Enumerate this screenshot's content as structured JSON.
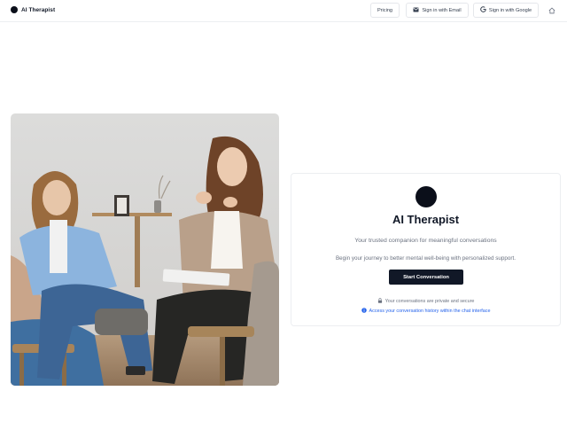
{
  "header": {
    "brand": "AI Therapist",
    "nav": {
      "pricing": "Pricing",
      "email": "Sign in with Email",
      "google": "Sign in with Google"
    }
  },
  "hero": {
    "icon": "group-therapy-photo"
  },
  "card": {
    "title": "AI Therapist",
    "subtitle": "Your trusted companion for meaningful conversations",
    "description": "Begin your journey to better mental well-being with personalized support.",
    "button": "Start Conversation",
    "privacy": "Your conversations are private and secure",
    "history": "Access your conversation history within the chat interface"
  },
  "colors": {
    "accent": "#111827",
    "link": "#2563eb",
    "muted": "#6b7280",
    "border": "#e5e7eb"
  }
}
